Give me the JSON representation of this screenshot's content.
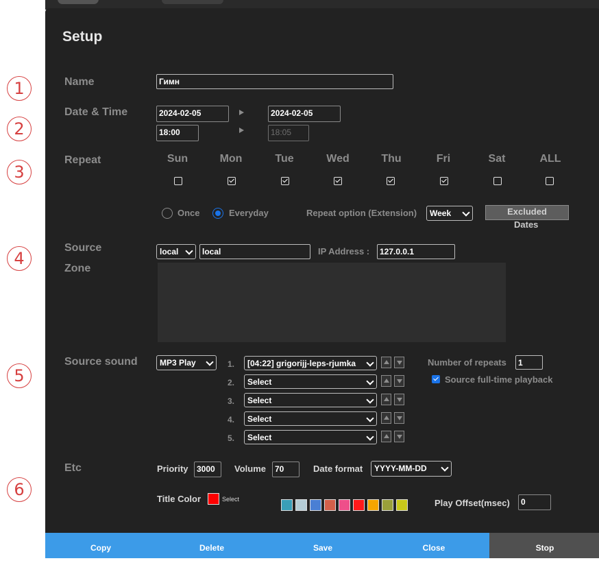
{
  "dialog": {
    "title": "Setup"
  },
  "markers": [
    "1",
    "2",
    "3",
    "4",
    "5",
    "6"
  ],
  "name": {
    "label": "Name",
    "value": "Гимн"
  },
  "datetime": {
    "label": "Date & Time",
    "start_date": "2024-02-05",
    "end_date": "2024-02-05",
    "start_time": "18:00",
    "end_time": "18:05"
  },
  "repeat": {
    "label": "Repeat",
    "days": [
      {
        "label": "Sun",
        "checked": false
      },
      {
        "label": "Mon",
        "checked": true
      },
      {
        "label": "Tue",
        "checked": true
      },
      {
        "label": "Wed",
        "checked": true
      },
      {
        "label": "Thu",
        "checked": true
      },
      {
        "label": "Fri",
        "checked": true
      },
      {
        "label": "Sat",
        "checked": false
      },
      {
        "label": "ALL",
        "checked": false
      }
    ],
    "once_label": "Once",
    "everyday_label": "Everyday",
    "selected_mode": "Everyday",
    "option_label": "Repeat option (Extension)",
    "option_value": "Week",
    "excluded_line1": "Excluded",
    "excluded_line2": "Dates"
  },
  "source": {
    "label": "Source",
    "zone_label": "Zone",
    "type_value": "local",
    "name_value": "local",
    "ip_label": "IP Address :",
    "ip_value": "127.0.0.1"
  },
  "sound": {
    "label": "Source sound",
    "player_value": "MP3 Play",
    "tracks": [
      {
        "num": "1.",
        "value": "[04:22] grigorijj-leps-rjumka"
      },
      {
        "num": "2.",
        "value": "Select"
      },
      {
        "num": "3.",
        "value": "Select"
      },
      {
        "num": "4.",
        "value": "Select"
      },
      {
        "num": "5.",
        "value": "Select"
      }
    ],
    "repeats_label": "Number of repeats",
    "repeats_value": "1",
    "fulltime_label": "Source full-time playback",
    "fulltime_checked": true
  },
  "etc": {
    "label": "Etc",
    "priority_label": "Priority",
    "priority_value": "3000",
    "volume_label": "Volume",
    "volume_value": "70",
    "date_format_label": "Date format",
    "date_format_value": "YYYY-MM-DD",
    "title_color_label": "Title Color",
    "title_color_value": "#ff0000",
    "select_label": "Select",
    "swatches": [
      "#3a9fb8",
      "#b5cdd6",
      "#4a7fd4",
      "#d4604a",
      "#ee4f8a",
      "#ff1a1a",
      "#f5a500",
      "#9aa03a",
      "#c8c81a"
    ],
    "offset_label": "Play Offset(msec)",
    "offset_value": "0"
  },
  "footer": {
    "copy": "Copy",
    "delete": "Delete",
    "save": "Save",
    "close": "Close",
    "stop": "Stop"
  }
}
